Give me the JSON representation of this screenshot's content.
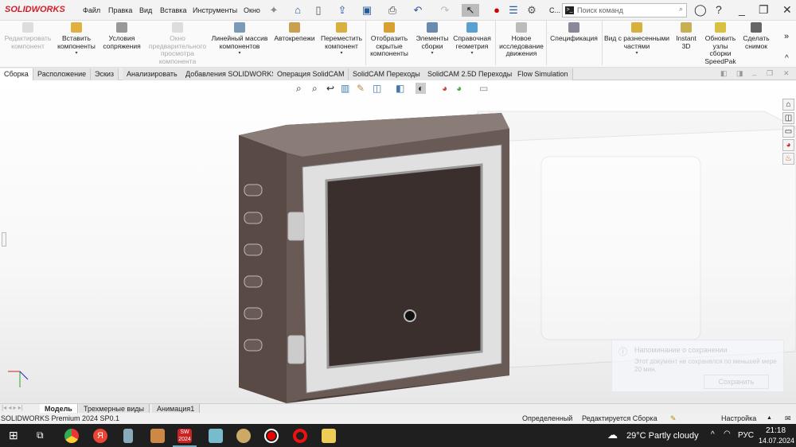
{
  "app": {
    "logo": "SOLIDWORKS",
    "menu": [
      "Файл",
      "Правка",
      "Вид",
      "Вставка",
      "Инструменты",
      "Окно"
    ],
    "search_placeholder": "Поиск команд",
    "more": "C..."
  },
  "ribbon": [
    {
      "label": "Редактировать компонент",
      "disabled": true
    },
    {
      "label": "Вставить компоненты"
    },
    {
      "label": "Условия сопряжения"
    },
    {
      "label": "Окно предварительного просмотра компонента",
      "disabled": true
    },
    {
      "label": "Линейный массив компонентов"
    },
    {
      "label": "Автокрепежи"
    },
    {
      "label": "Переместить компонент"
    },
    {
      "label": "Отобразить скрытые компоненты"
    },
    {
      "label": "Элементы сборки"
    },
    {
      "label": "Справочная геометрия"
    },
    {
      "label": "Новое исследование движения"
    },
    {
      "label": "Спецификация"
    },
    {
      "label": "Вид с разнесенными частями"
    },
    {
      "label": "Instant 3D"
    },
    {
      "label": "Обновить узлы сборки SpeedPak"
    },
    {
      "label": "Сделать снимок"
    }
  ],
  "tabs": [
    "Сборка",
    "Расположение",
    "Эскиз",
    "Анализировать",
    "Добавления SOLIDWORKS",
    "Операция  SolidCAM",
    "SolidCAM Переходы",
    "SolidCAM 2.5D Переходы",
    "Flow Simulation"
  ],
  "toast": {
    "title": "Напоминание о сохранении",
    "body": "Этот документ не сохранялся по меньшей мере 20 мин.",
    "button": "Сохранить"
  },
  "bottom_tabs": [
    "Модель",
    "Трехмерные виды",
    "Анимация1"
  ],
  "status": {
    "version": "SOLIDWORKS Premium 2024 SP0.1",
    "state": "Определенный",
    "editing": "Редактируется Сборка",
    "settings": "Настройка"
  },
  "taskbar": {
    "weather": "29°C  Partly cloudy",
    "lang": "РУС",
    "time": "21:18",
    "date": "14.07.2024"
  },
  "colors": {
    "brand": "#d0202a",
    "taskbar": "#1f1f1f"
  }
}
